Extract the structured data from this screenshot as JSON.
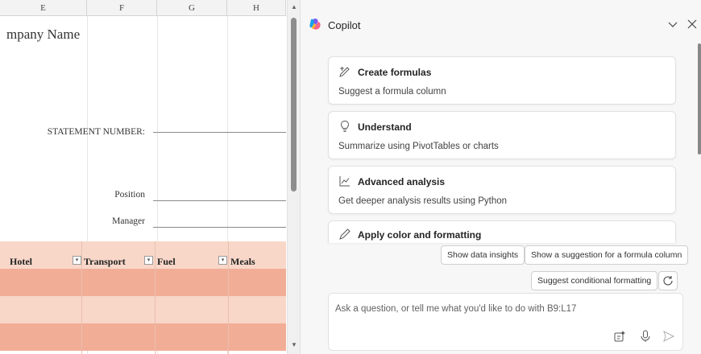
{
  "sheet": {
    "columns": [
      "E",
      "F",
      "G",
      "H"
    ],
    "company_name": "mpany Name",
    "statement_label": "STATEMENT NUMBER:",
    "position_label": "Position",
    "manager_label": "Manager",
    "table_headers": [
      "Hotel",
      "Transport",
      "Fuel",
      "Meals"
    ]
  },
  "copilot": {
    "title": "Copilot",
    "cards": [
      {
        "icon": "formula-pencil-icon",
        "title": "Create formulas",
        "subtitle": "Suggest a formula column"
      },
      {
        "icon": "lightbulb-icon",
        "title": "Understand",
        "subtitle": "Summarize using PivotTables or charts"
      },
      {
        "icon": "line-chart-icon",
        "title": "Advanced analysis",
        "subtitle": "Get deeper analysis results using Python"
      },
      {
        "icon": "paint-pen-icon",
        "title": "Apply color and formatting",
        "subtitle": ""
      }
    ],
    "suggestions": [
      "Show data insights",
      "Show a suggestion for a formula column",
      "Suggest conditional formatting"
    ],
    "input_placeholder": "Ask a question, or tell me what you'd like to do with B9:L17"
  },
  "colors": {
    "accent_orange": "#f2ad97",
    "light_orange": "#f8d6c8",
    "pane_bg": "#f7f7f7"
  }
}
